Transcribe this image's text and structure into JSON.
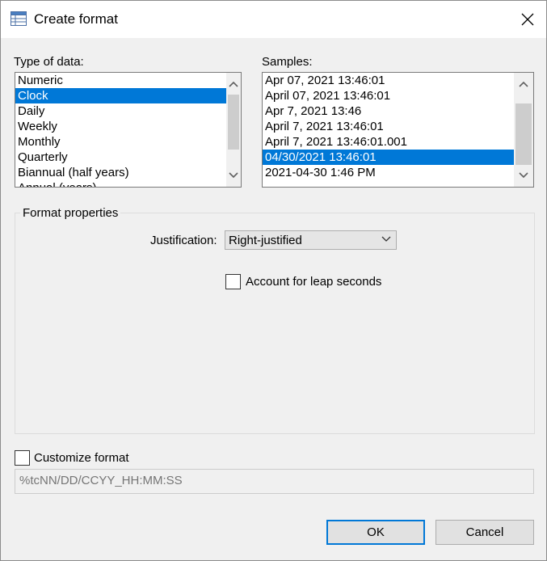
{
  "window": {
    "title": "Create format"
  },
  "type_of_data": {
    "label": "Type of data:",
    "items": [
      {
        "label": "Numeric",
        "selected": false
      },
      {
        "label": "Clock",
        "selected": true
      },
      {
        "label": "Daily",
        "selected": false
      },
      {
        "label": "Weekly",
        "selected": false
      },
      {
        "label": "Monthly",
        "selected": false
      },
      {
        "label": "Quarterly",
        "selected": false
      },
      {
        "label": "Biannual (half years)",
        "selected": false
      },
      {
        "label": "Annual (years)",
        "selected": false
      }
    ]
  },
  "samples": {
    "label": "Samples:",
    "items": [
      {
        "label": "Apr 07, 2021 13:46:01",
        "selected": false
      },
      {
        "label": "April 07, 2021 13:46:01",
        "selected": false
      },
      {
        "label": "Apr 7, 2021 13:46",
        "selected": false
      },
      {
        "label": "April 7, 2021 13:46:01",
        "selected": false
      },
      {
        "label": "April 7, 2021 13:46:01.001",
        "selected": false
      },
      {
        "label": "04/30/2021 13:46:01",
        "selected": true
      },
      {
        "label": "2021-04-30 1:46 PM",
        "selected": false
      }
    ]
  },
  "format_properties": {
    "title": "Format properties",
    "justification_label": "Justification:",
    "justification_value": "Right-justified",
    "leap_seconds_label": "Account for leap seconds",
    "leap_seconds_checked": false
  },
  "customize": {
    "label": "Customize format",
    "checked": false,
    "placeholder": "%tcNN/DD/CCYY_HH:MM:SS"
  },
  "buttons": {
    "ok": "OK",
    "cancel": "Cancel"
  },
  "colors": {
    "selection": "#0078d7",
    "default_button_border": "#0078d7"
  }
}
